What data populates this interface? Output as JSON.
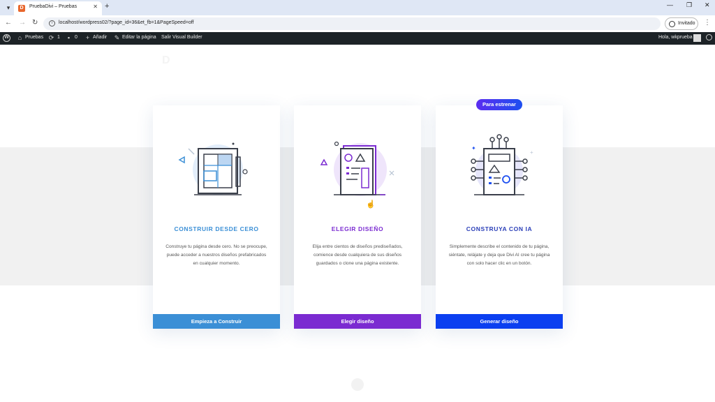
{
  "browser": {
    "tab_title": "PruebaDivi – Pruebas",
    "tab_favicon": "D",
    "url": "localhost/wordpress02/?page_id=36&et_fb=1&PageSpeed=off",
    "profile_label": "Invitado"
  },
  "adminbar": {
    "site_name": "Pruebas",
    "updates_count": "1",
    "comments_count": "0",
    "add_new": "Añadir",
    "edit_page": "Editar la página",
    "exit_builder": "Salir Visual Builder",
    "greeting": "Hola, wkprueba"
  },
  "cards": [
    {
      "title": "CONSTRUIR DESDE CERO",
      "description": "Construye tu página desde cero. No se preocupe, puede acceder a nuestros diseños prefabricados en cualquier momento.",
      "button": "Empieza a Construir",
      "accent": "#3b8fd6"
    },
    {
      "title": "ELEGIR DISEÑO",
      "description": "Elija entre cientos de diseños prediseñados, comience desde cualquiera de sus diseños guardados o clone una página existente.",
      "button": "Elegir diseño",
      "accent": "#7b2bd1"
    },
    {
      "title": "CONSTRUYA CON IA",
      "badge": "Para estrenar",
      "description": "Simplemente describe el contenido de tu página, siéntate, relájate y deja que Divi AI cree tu página con solo hacer clic en un botón.",
      "button": "Generar diseño",
      "accent": "#0b3ff0"
    }
  ]
}
